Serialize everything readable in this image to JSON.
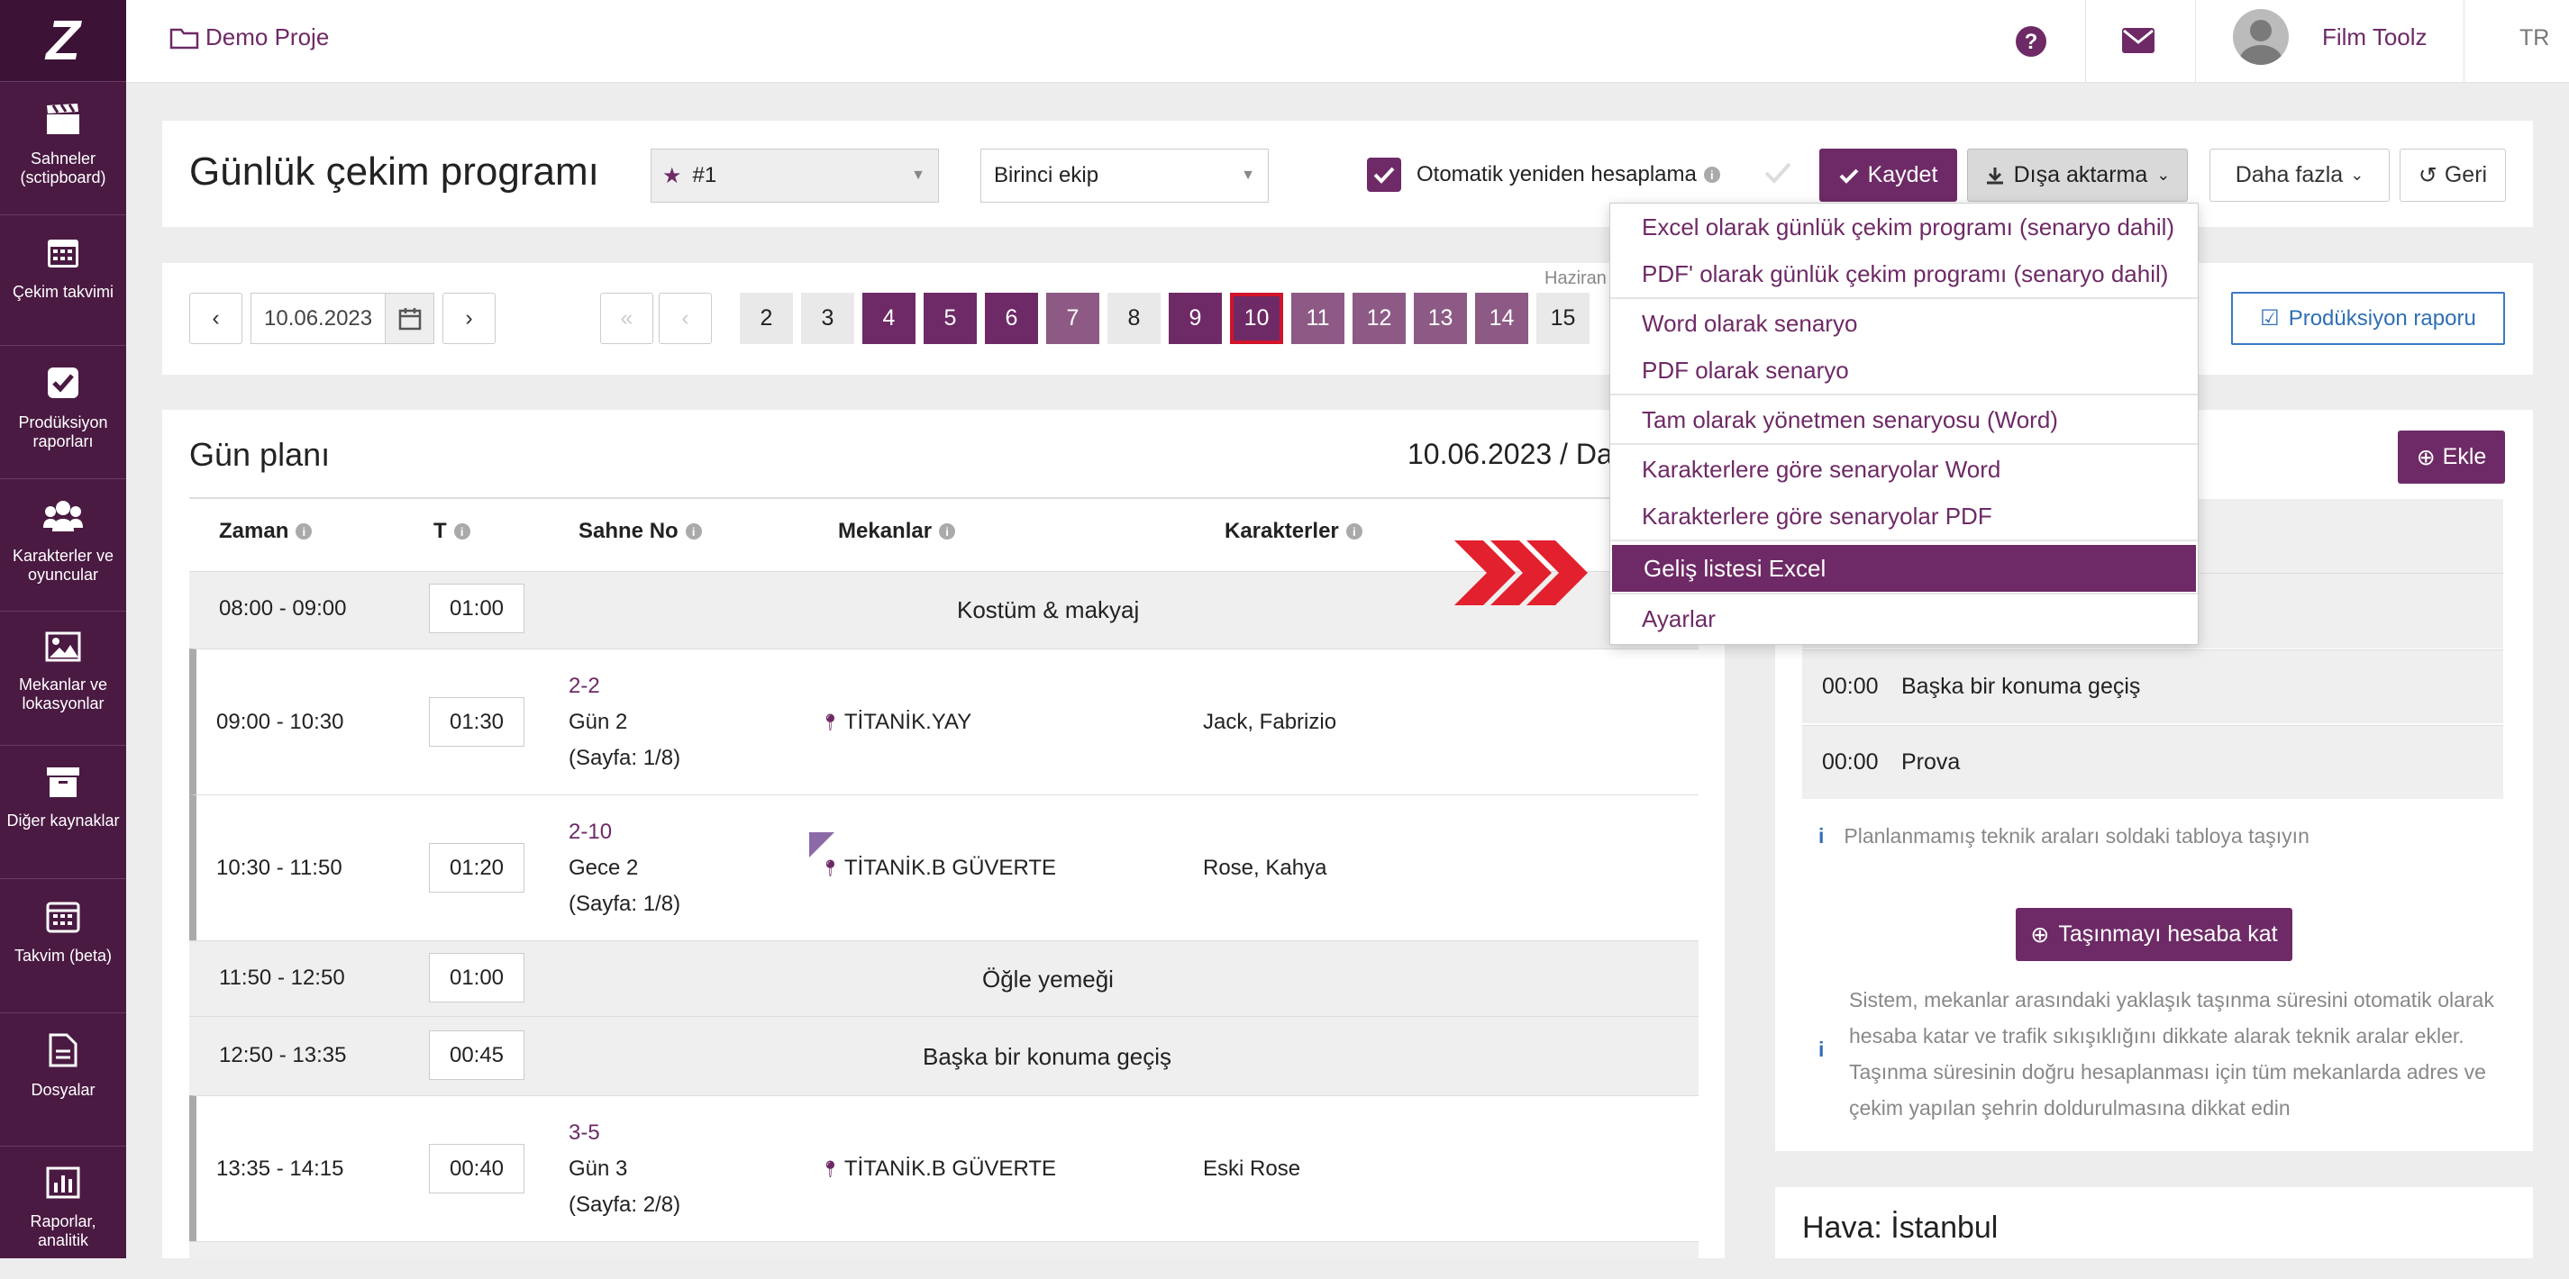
{
  "sidebar": {
    "logo": "Z",
    "items": [
      {
        "label": "Sahneler (sctipboard)",
        "icon": "clapperboard-icon"
      },
      {
        "label": "Çekim takvimi",
        "icon": "calendar-icon"
      },
      {
        "label": "Prodüksiyon raporları",
        "icon": "check-square-icon"
      },
      {
        "label": "Karakterler ve oyuncular",
        "icon": "users-icon"
      },
      {
        "label": "Mekanlar ve lokasyonlar",
        "icon": "image-icon"
      },
      {
        "label": "Diğer kaynaklar",
        "icon": "archive-icon"
      },
      {
        "label": "Takvim (beta)",
        "icon": "calendar-grid-icon"
      },
      {
        "label": "Dosyalar",
        "icon": "file-icon"
      },
      {
        "label": "Raporlar, analitik",
        "icon": "bar-chart-icon"
      }
    ]
  },
  "topbar": {
    "project": "Demo Proje",
    "user": "Film Toolz",
    "lang": "TR"
  },
  "header": {
    "title": "Günlük çekim programı",
    "schedule_select": "#1",
    "team_select": "Birinci ekip",
    "auto_recalc_label": "Otomatik yeniden hesaplama",
    "save": "Kaydet",
    "export": "Dışa aktarma",
    "more": "Daha fazla",
    "back": "Geri"
  },
  "datebar": {
    "date": "10.06.2023",
    "month_label": "Haziran",
    "production_report": "Prodüksiyon raporu",
    "days": [
      {
        "n": "2",
        "style": "gray"
      },
      {
        "n": "3",
        "style": "gray"
      },
      {
        "n": "4",
        "style": "dark"
      },
      {
        "n": "5",
        "style": "dark"
      },
      {
        "n": "6",
        "style": "dark"
      },
      {
        "n": "7",
        "style": "mid"
      },
      {
        "n": "8",
        "style": "gray"
      },
      {
        "n": "9",
        "style": "dark"
      },
      {
        "n": "10",
        "style": "selected"
      },
      {
        "n": "11",
        "style": "mid"
      },
      {
        "n": "12",
        "style": "mid"
      },
      {
        "n": "13",
        "style": "mid"
      },
      {
        "n": "14",
        "style": "mid"
      },
      {
        "n": "15",
        "style": "gray"
      }
    ]
  },
  "dayplan": {
    "title": "Gün planı",
    "date_partial": "10.06.2023 / Da",
    "columns": {
      "time": "Zaman",
      "t": "T",
      "scene": "Sahne No",
      "locations": "Mekanlar",
      "characters": "Karakterler"
    },
    "rows": [
      {
        "time": "08:00 - 09:00",
        "t": "01:00",
        "event": "Kostüm & makyaj"
      },
      {
        "time": "09:00 - 10:30",
        "t": "01:30",
        "scene": "2-2",
        "day": "Gün 2",
        "page": "(Sayfa: 1/8)",
        "loc": "TİTANİK.YAY",
        "chars": "Jack, Fabrizio"
      },
      {
        "time": "10:30 - 11:50",
        "t": "01:20",
        "scene": "2-10",
        "day": "Gece 2",
        "page": "(Sayfa: 1/8)",
        "loc": "TİTANİK.B GÜVERTE",
        "chars": "Rose, Kahya"
      },
      {
        "time": "11:50 - 12:50",
        "t": "01:00",
        "event": "Öğle yemeği"
      },
      {
        "time": "12:50 - 13:35",
        "t": "00:45",
        "event": "Başka bir konuma geçiş"
      },
      {
        "time": "13:35 - 14:15",
        "t": "00:40",
        "scene": "3-5",
        "day": "Gün 3",
        "page": "(Sayfa: 2/8)",
        "loc": "TİTANİK.B GÜVERTE",
        "chars": "Eski Rose"
      }
    ]
  },
  "right": {
    "add": "Ekle",
    "rows": [
      {
        "t": "00:00",
        "label": "Başka bir konuma geçiş"
      },
      {
        "t": "00:00",
        "label": "Prova"
      }
    ],
    "hint": "Planlanmamış teknik araları soldaki tabloya taşıyın",
    "calc_button": "Taşınmayı hesaba kat",
    "description": "Sistem, mekanlar arasındaki yaklaşık taşınma süresini otomatik olarak hesaba katar ve trafik sıkışıklığını dikkate alarak teknik aralar ekler. Taşınma süresinin doğru hesaplanması için tüm mekanlarda adres ve çekim yapılan şehrin doldurulmasına dikkat edin",
    "weather": "Hava: İstanbul"
  },
  "export_menu": [
    "Excel olarak günlük çekim programı (senaryo dahil)",
    "PDF' olarak günlük çekim programı (senaryo dahil)",
    "Word olarak senaryo",
    "PDF olarak senaryo",
    "Tam olarak yönetmen senaryosu (Word)",
    "Karakterlere göre senaryolar Word",
    "Karakterlere göre senaryolar PDF",
    "Geliş listesi Excel",
    "Ayarlar"
  ],
  "colors": {
    "brand": "#6e2a66",
    "sidebar": "#4a1a42",
    "arrow": "#e3202e"
  }
}
